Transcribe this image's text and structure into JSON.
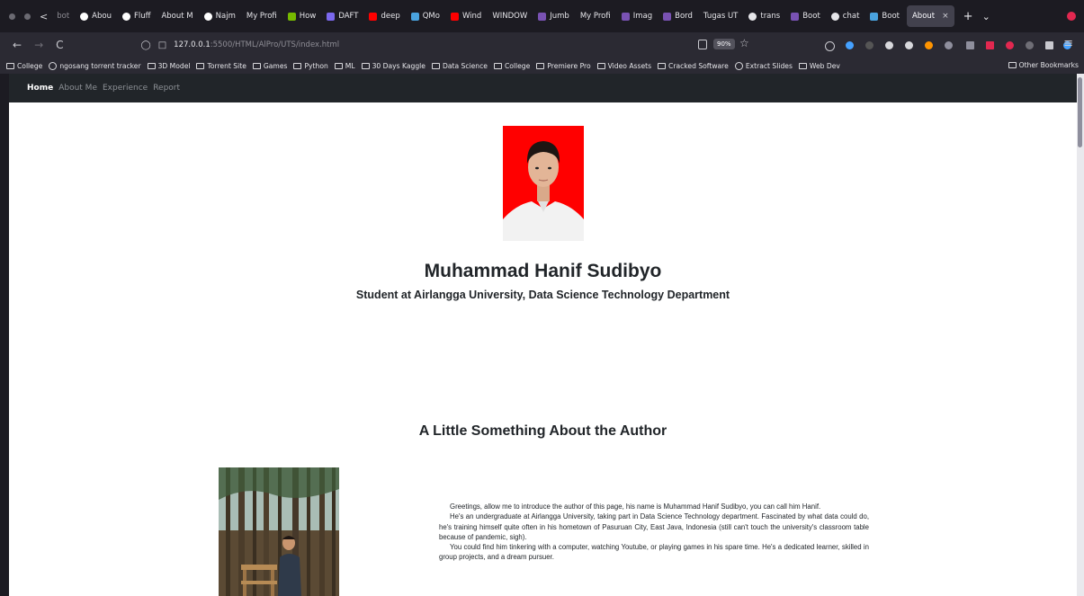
{
  "tabs": [
    {
      "label": "bot",
      "faded": true,
      "icon": "none",
      "color": ""
    },
    {
      "label": "Abou",
      "icon": "github-icon",
      "color": "#ffffff"
    },
    {
      "label": "Fluff",
      "icon": "github-icon",
      "color": "#ffffff"
    },
    {
      "label": "About M",
      "icon": "none",
      "color": ""
    },
    {
      "label": "Najm",
      "icon": "github-icon",
      "color": "#ffffff"
    },
    {
      "label": "My Profi",
      "icon": "none",
      "color": ""
    },
    {
      "label": "How",
      "icon": "nvidia-icon",
      "color": "#76b900"
    },
    {
      "label": "DAFT",
      "icon": "doc-icon",
      "color": "#7b68ee"
    },
    {
      "label": "deep",
      "icon": "youtube-icon",
      "color": "#ff0000"
    },
    {
      "label": "QMo",
      "icon": "qmo-icon",
      "color": "#4aa3df"
    },
    {
      "label": "Wind",
      "icon": "youtube-icon",
      "color": "#ff0000"
    },
    {
      "label": "WINDOW",
      "icon": "none",
      "color": ""
    },
    {
      "label": "Jumb",
      "icon": "bootstrap-icon",
      "color": "#7952b3"
    },
    {
      "label": "My Profi",
      "icon": "none",
      "color": ""
    },
    {
      "label": "Imag",
      "icon": "bootstrap-icon",
      "color": "#7952b3"
    },
    {
      "label": "Bord",
      "icon": "bootstrap-icon",
      "color": "#7952b3"
    },
    {
      "label": "Tugas UT",
      "icon": "none",
      "color": ""
    },
    {
      "label": "trans",
      "icon": "chrome-icon",
      "color": "#e6e6ea"
    },
    {
      "label": "Boot",
      "icon": "bootstrap-icon",
      "color": "#7952b3"
    },
    {
      "label": "chat",
      "icon": "chrome-icon",
      "color": "#e6e6ea"
    },
    {
      "label": "Boot",
      "icon": "feather-icon",
      "color": "#4aa3df"
    }
  ],
  "active_tab": {
    "label": "About",
    "close": "×"
  },
  "tab_controls": {
    "new_tab": "+",
    "list_tabs": "⌄"
  },
  "nav": {
    "back": "←",
    "forward": "→",
    "reload": "C"
  },
  "address": {
    "host": "127.0.0.1",
    "rest": ":5500/HTML/AlPro/UTS/index.html",
    "zoom": "90%"
  },
  "bookmarks": [
    {
      "label": "College",
      "icon": "folder"
    },
    {
      "label": "ngosang torrent tracker",
      "icon": "globe"
    },
    {
      "label": "3D Model",
      "icon": "folder"
    },
    {
      "label": "Torrent Site",
      "icon": "folder"
    },
    {
      "label": "Games",
      "icon": "folder"
    },
    {
      "label": "Python",
      "icon": "folder"
    },
    {
      "label": "ML",
      "icon": "folder"
    },
    {
      "label": "30 Days Kaggle",
      "icon": "folder"
    },
    {
      "label": "Data Science",
      "icon": "folder"
    },
    {
      "label": "College",
      "icon": "folder"
    },
    {
      "label": "Premiere Pro",
      "icon": "folder"
    },
    {
      "label": "Video Assets",
      "icon": "folder"
    },
    {
      "label": "Cracked Software",
      "icon": "folder"
    },
    {
      "label": "Extract Slides",
      "icon": "globe"
    },
    {
      "label": "Web Dev",
      "icon": "folder"
    }
  ],
  "other_bookmarks": "Other Bookmarks",
  "site_nav": [
    "Home",
    "About Me",
    "Experience",
    "Report"
  ],
  "profile": {
    "name": "Muhammad Hanif Sudibyo",
    "role": "Student at Airlangga University, Data Science Technology Department"
  },
  "about": {
    "title": "A Little Something About the Author",
    "paragraphs": [
      "Greetings, allow me to introduce the author of this page, his name is Muhammad Hanif Sudibyo, you can call him Hanif.",
      "He's an undergraduate at Airlangga University, taking part in Data Science Technology department. Fascinated by what data could do, he's training himself quite often in his hometown of Pasuruan City, East Java, Indonesia (still can't touch the university's classroom table because of pandemic, sigh).",
      "You could find him tinkering with a computer, watching Youtube, or playing games in his spare time. He's a dedicated learner, skilled in group projects, and a dream pursuer."
    ]
  },
  "colors": {
    "accent_dark": "#212529",
    "portrait_bg": "#ff0000",
    "record": "#e22850"
  }
}
